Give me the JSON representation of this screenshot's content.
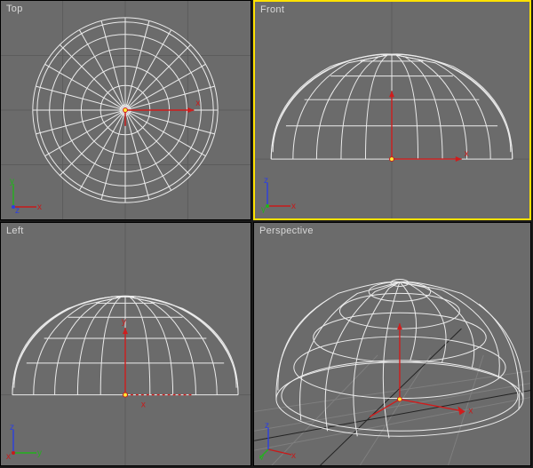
{
  "viewports": {
    "top": {
      "label": "Top",
      "active": false
    },
    "front": {
      "label": "Front",
      "active": true
    },
    "left": {
      "label": "Left",
      "active": false
    },
    "perspective": {
      "label": "Perspective",
      "active": false
    }
  },
  "object": {
    "type": "hemisphere-wireframe",
    "segments_lon": 24,
    "segments_lat": 6,
    "color": "#ececec"
  },
  "axis_labels": {
    "x": "x",
    "y": "y",
    "z": "z"
  },
  "gizmo_color": "#d01c1c",
  "grid_color": "#7f7f7f",
  "active_border_color": "#ffe200",
  "panel_bg": "#6b6b6b"
}
